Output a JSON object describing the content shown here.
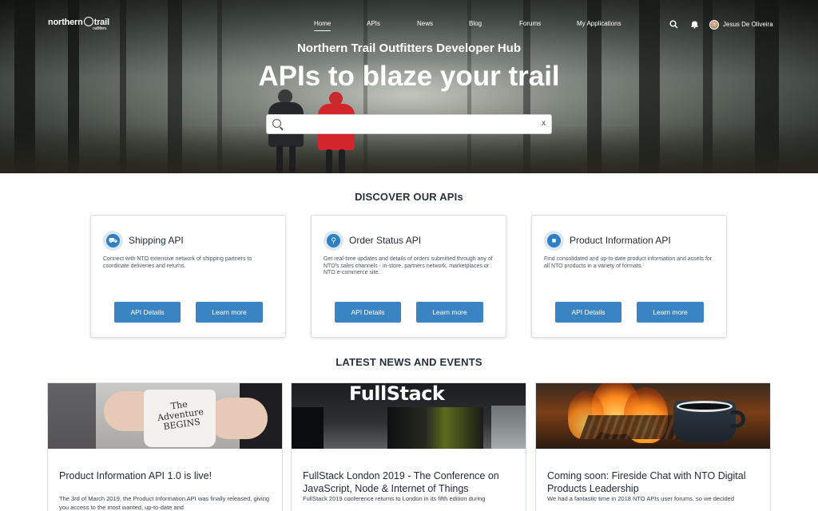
{
  "nav": {
    "logo_text": "northern",
    "logo_text2": "trail",
    "logo_sub": "outfitters",
    "items": [
      {
        "label": "Home",
        "active": true
      },
      {
        "label": "APIs"
      },
      {
        "label": "News"
      },
      {
        "label": "Blog"
      },
      {
        "label": "Forums"
      },
      {
        "label": "My Applications"
      }
    ],
    "user_name": "Jesus De Oliveira"
  },
  "hero": {
    "subtitle": "Northern Trail Outfitters Developer Hub",
    "title": "APIs to blaze your trail",
    "search_value": "",
    "clear_glyph": "x"
  },
  "apis": {
    "heading": "DISCOVER OUR APIs",
    "cards": [
      {
        "name": "Shipping API",
        "icon": "truck-icon",
        "description": "Connect with NTO extensive network of shipping partners to coordinate deliveries and returns.",
        "details_label": "API Details",
        "learn_label": "Learn more"
      },
      {
        "name": "Order Status API",
        "icon": "cart-icon",
        "description": "Get real-time updates and details of orders submitted through any of NTO's sales channels - in-store, partners network, marketplaces or NTO e-commerce site.",
        "details_label": "API Details",
        "learn_label": "Learn more"
      },
      {
        "name": "Product Information API",
        "icon": "jacket-icon",
        "description": "Find consolidated and up-to-date product information and assets for all NTO products in a variety of formats.",
        "details_label": "API Details",
        "learn_label": "Learn more"
      }
    ]
  },
  "news": {
    "heading": "LATEST NEWS AND EVENTS",
    "items": [
      {
        "title": "Product Information API 1.0 is live!",
        "text": "The 3rd of March 2019, the Product Information API was finally released, giving you access to the most wanted, up-to-date and",
        "image_text": "The Adventure BEGINS"
      },
      {
        "title": "FullStack London 2019 - The Conference on JavaScript, Node & Internet of Things",
        "text": "FullStack 2019 conference returns to London in its fifth edition during",
        "image_text": "FullStack"
      },
      {
        "title": "Coming soon: Fireside Chat with NTO Digital Products Leadership",
        "text": "We had a fantastic time in 2018 NTO APIs user forums, so we decided"
      }
    ]
  }
}
